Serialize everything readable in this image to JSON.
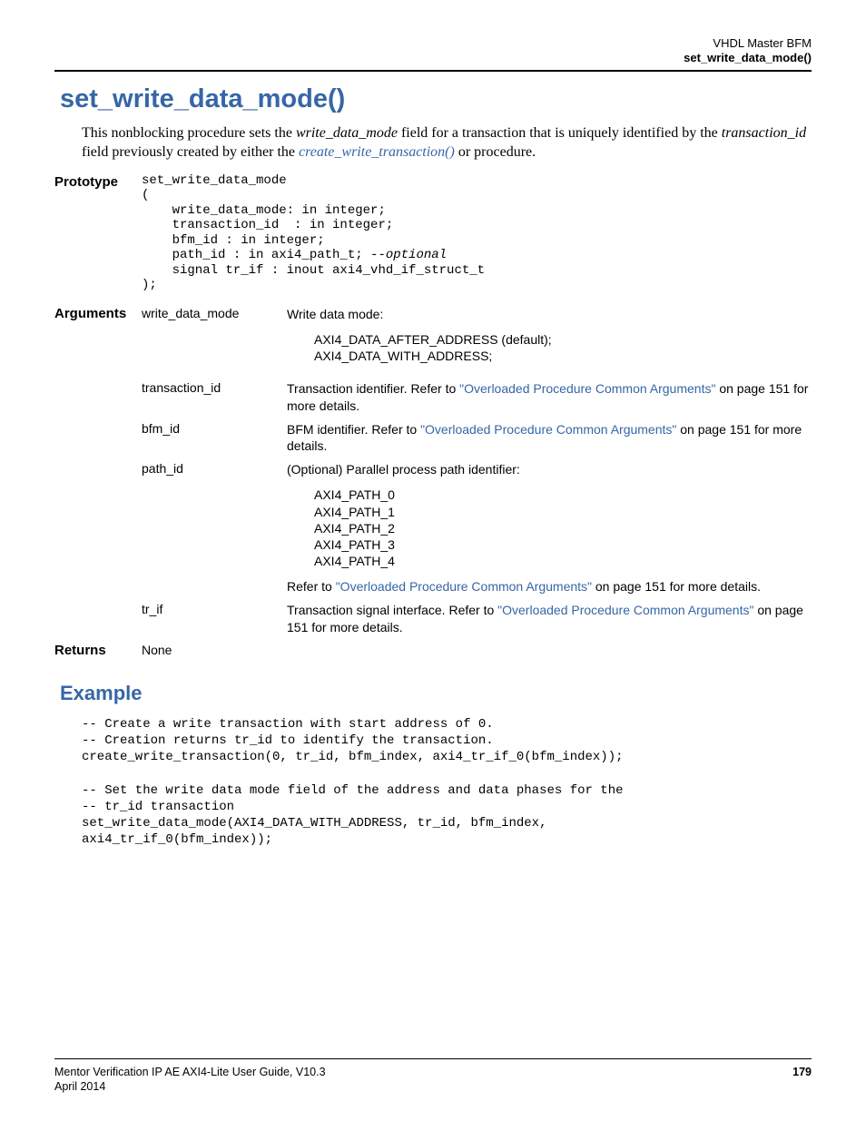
{
  "header": {
    "chapter": "VHDL Master BFM",
    "topic": "set_write_data_mode()"
  },
  "title": "set_write_data_mode()",
  "intro": {
    "t1": "This nonblocking procedure sets the ",
    "i1": "write_data_mode",
    "t2": " field for a transaction that is uniquely identified by the ",
    "i2": "transaction_id",
    "t3": " field previously created by either the ",
    "link1": "create_write_transaction()",
    "t4": " or  procedure."
  },
  "prototype": {
    "label": "Prototype",
    "code": "set_write_data_mode\n(\n    write_data_mode: in integer;\n    transaction_id  : in integer;\n    bfm_id : in integer;\n    path_id : in axi4_path_t; --optional\n    signal tr_if : inout axi4_vhd_if_struct_t\n);"
  },
  "arguments": {
    "label": "Arguments",
    "items": [
      {
        "name": "write_data_mode",
        "desc": "Write data mode:",
        "values": "AXI4_DATA_AFTER_ADDRESS (default);\nAXI4_DATA_WITH_ADDRESS;"
      },
      {
        "name": "transaction_id",
        "desc_pre": "Transaction identifier. Refer to ",
        "link": "\"Overloaded Procedure Common Arguments\"",
        "desc_post": " on page 151 for more details."
      },
      {
        "name": "bfm_id",
        "desc_pre": "BFM identifier. Refer to ",
        "link": "\"Overloaded Procedure Common Arguments\"",
        "desc_post": " on page 151 for more details."
      },
      {
        "name": "path_id",
        "desc": "(Optional) Parallel process path identifier:",
        "values": "AXI4_PATH_0\nAXI4_PATH_1\nAXI4_PATH_2\nAXI4_PATH_3\nAXI4_PATH_4",
        "refer_pre": "Refer to ",
        "refer_link": "\"Overloaded Procedure Common Arguments\"",
        "refer_post": " on page 151 for more details."
      },
      {
        "name": "tr_if",
        "desc_pre": "Transaction signal interface. Refer to ",
        "link": "\"Overloaded Procedure Common Arguments\"",
        "desc_post": " on page 151 for more details."
      }
    ]
  },
  "returns": {
    "label": "Returns",
    "value": "None"
  },
  "example": {
    "title": "Example",
    "code": "-- Create a write transaction with start address of 0.\n-- Creation returns tr_id to identify the transaction.\ncreate_write_transaction(0, tr_id, bfm_index, axi4_tr_if_0(bfm_index));\n\n-- Set the write data mode field of the address and data phases for the\n-- tr_id transaction\nset_write_data_mode(AXI4_DATA_WITH_ADDRESS, tr_id, bfm_index,\naxi4_tr_if_0(bfm_index));"
  },
  "footer": {
    "guide": "Mentor Verification IP AE AXI4-Lite User Guide, V10.3",
    "date": "April 2014",
    "page": "179"
  }
}
